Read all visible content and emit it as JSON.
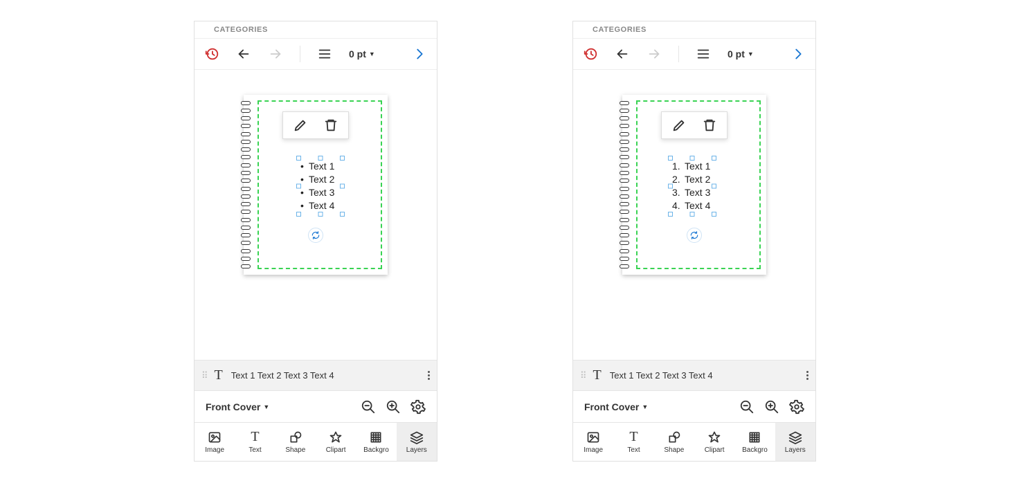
{
  "panels": [
    {
      "categories_label": "CATEGORIES",
      "pt_label": "0 pt",
      "list_style": "bullet",
      "items": [
        {
          "marker": "•",
          "text": "Text 1"
        },
        {
          "marker": "•",
          "text": "Text 2"
        },
        {
          "marker": "•",
          "text": "Text 3"
        },
        {
          "marker": "•",
          "text": "Text 4"
        }
      ],
      "layer_text": "Text 1 Text 2 Text 3 Text 4",
      "page_name": "Front Cover",
      "tabs": [
        "Image",
        "Text",
        "Shape",
        "Clipart",
        "Backgro",
        "Layers"
      ],
      "active_tab": 5
    },
    {
      "categories_label": "CATEGORIES",
      "pt_label": "0 pt",
      "list_style": "number",
      "items": [
        {
          "marker": "1.",
          "text": "Text 1"
        },
        {
          "marker": "2.",
          "text": "Text 2"
        },
        {
          "marker": "3.",
          "text": "Text 3"
        },
        {
          "marker": "4.",
          "text": "Text 4"
        }
      ],
      "layer_text": "Text 1 Text 2 Text 3 Text 4",
      "page_name": "Front Cover",
      "tabs": [
        "Image",
        "Text",
        "Shape",
        "Clipart",
        "Backgro",
        "Layers"
      ],
      "active_tab": 5
    }
  ]
}
